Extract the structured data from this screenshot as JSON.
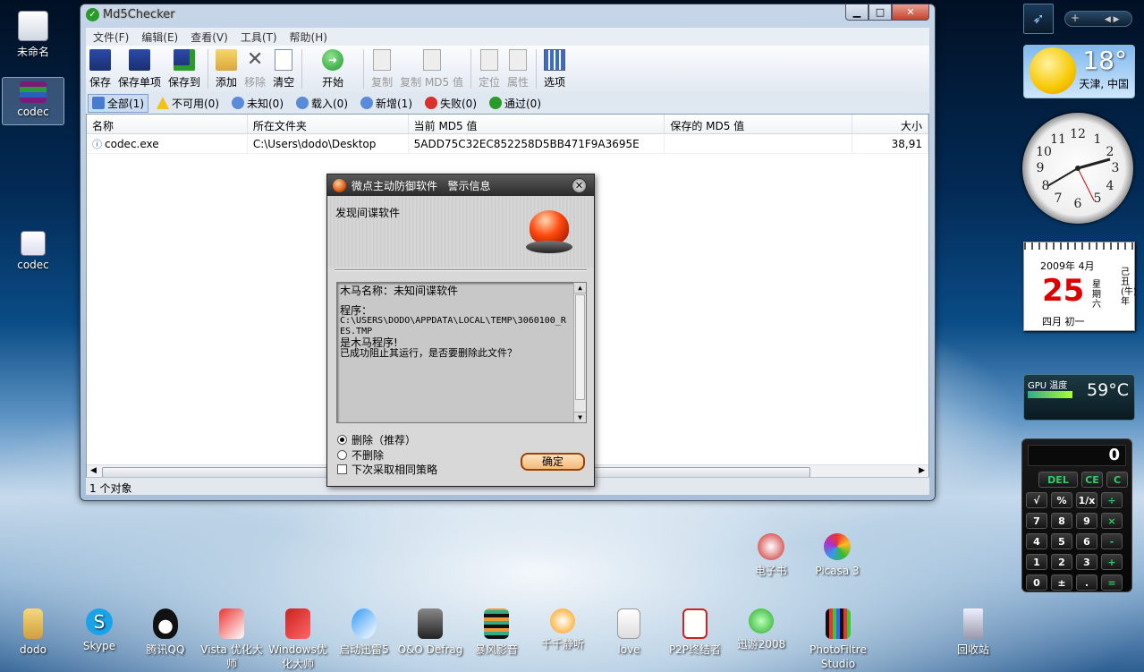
{
  "desktop": {
    "icons": [
      {
        "label": "未命名"
      },
      {
        "label": "codec"
      },
      {
        "label": "codec"
      }
    ],
    "bottom_icons": [
      {
        "label": "dodo"
      },
      {
        "label": "Skype"
      },
      {
        "label": "腾讯QQ"
      },
      {
        "label": "Vista 优化大师"
      },
      {
        "label": "Windows优化大师"
      },
      {
        "label": "启动迅雷5"
      },
      {
        "label": "O&O Defrag"
      },
      {
        "label": "暴风影音"
      },
      {
        "label": "千千静听"
      },
      {
        "label": "love"
      },
      {
        "label": "P2P终结者"
      },
      {
        "label": "迅游2008"
      },
      {
        "label": "PhotoFiltre Studio"
      },
      {
        "label": "回收站"
      }
    ],
    "mid_icons": [
      {
        "label": "电子书"
      },
      {
        "label": "Picasa 3"
      }
    ]
  },
  "window": {
    "title": "Md5Checker",
    "menu": [
      "文件(F)",
      "编辑(E)",
      "查看(V)",
      "工具(T)",
      "帮助(H)"
    ],
    "toolbar": {
      "save": "保存",
      "save_single": "保存单项",
      "save_to": "保存到",
      "add": "添加",
      "remove": "移除",
      "clear": "清空",
      "start": "开始",
      "copy": "复制",
      "copy_md5": "复制 MD5 值",
      "locate": "定位",
      "props": "属性",
      "options": "选项"
    },
    "filters": [
      "全部(1)",
      "不可用(0)",
      "未知(0)",
      "载入(0)",
      "新增(1)",
      "失败(0)",
      "通过(0)"
    ],
    "columns": [
      "名称",
      "所在文件夹",
      "当前 MD5 值",
      "保存的 MD5 值",
      "大小"
    ],
    "rows": [
      {
        "name": "codec.exe",
        "folder": "C:\\Users\\dodo\\Desktop",
        "md5": "5ADD75C32EC852258D5BB471F9A3695E",
        "saved": "",
        "size": "38,91"
      }
    ],
    "status": "1 个对象"
  },
  "dialog": {
    "title": "微点主动防御软件   警示信息",
    "heading": "发现间谍软件",
    "message": {
      "line1": "木马名称：未知间谍软件",
      "line2": "程序：",
      "line3": "C:\\USERS\\DODO\\APPDATA\\LOCAL\\TEMP\\3060100_RES.TMP",
      "line4": "是木马程序!",
      "line5": "已成功阻止其运行，是否要删除此文件？"
    },
    "options": {
      "delete": "删除（推荐）",
      "nodelete": "不删除",
      "same": "下次采取相同策略"
    },
    "ok": "确定"
  },
  "gadgets": {
    "weather": {
      "temp": "18°",
      "city": "天津, 中国"
    },
    "calendar": {
      "month": "2009年 4月",
      "day": "25",
      "weekday": "星期六",
      "year_gz": "己丑(牛)年",
      "lunar": "四月 初一"
    },
    "gpu": {
      "label": "GPU 温度",
      "value": "59°C"
    },
    "calculator": {
      "display": "0",
      "keys": [
        [
          "DEL",
          "CE",
          "C"
        ],
        [
          "√",
          "%",
          "1/x",
          "÷"
        ],
        [
          "7",
          "8",
          "9",
          "×"
        ],
        [
          "4",
          "5",
          "6",
          "-"
        ],
        [
          "1",
          "2",
          "3",
          "+"
        ],
        [
          "0",
          "±",
          ".",
          "="
        ]
      ]
    }
  }
}
